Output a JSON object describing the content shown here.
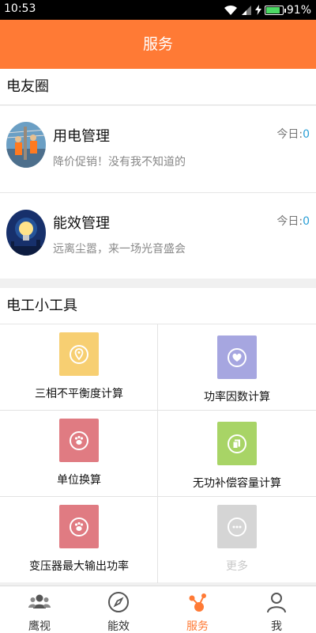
{
  "status_bar": {
    "time": "10:53",
    "battery_percent_label": "91%",
    "battery_level": 0.91
  },
  "header": {
    "title": "服务"
  },
  "circle_section": {
    "title": "电友圈",
    "items": [
      {
        "title": "用电管理",
        "subtitle": "降价促销！没有我不知道的",
        "today_label": "今日:",
        "today_count": "0",
        "avatar_icon": "power-line-worker-avatar"
      },
      {
        "title": "能效管理",
        "subtitle": "远离尘嚣，来一场光音盛会",
        "today_label": "今日:",
        "today_count": "0",
        "avatar_icon": "light-bulb-avatar"
      }
    ]
  },
  "tools_section": {
    "title": "电工小工具",
    "tools": [
      {
        "label": "三相不平衡度计算",
        "icon": "location-pin-icon",
        "color": "#f7cf72"
      },
      {
        "label": "功率因数计算",
        "icon": "heart-icon",
        "color": "#a6a6e0"
      },
      {
        "label": "单位换算",
        "icon": "paw-icon",
        "color": "#e07b82"
      },
      {
        "label": "无功补偿容量计算",
        "icon": "copy-icon",
        "color": "#a8d466"
      },
      {
        "label": "变压器最大输出功率",
        "icon": "paw-icon",
        "color": "#e07b82"
      },
      {
        "label": "更多",
        "icon": "more-icon",
        "color": "#d5d5d5"
      }
    ]
  },
  "tab_bar": {
    "tabs": [
      {
        "label": "鹰视",
        "icon": "people-group-icon",
        "active": false
      },
      {
        "label": "能效",
        "icon": "compass-icon",
        "active": false
      },
      {
        "label": "服务",
        "icon": "share-nodes-icon",
        "active": true
      },
      {
        "label": "我",
        "icon": "person-icon",
        "active": false
      }
    ]
  },
  "colors": {
    "brand": "#ff7a35",
    "count_accent": "#2a9fd6"
  }
}
